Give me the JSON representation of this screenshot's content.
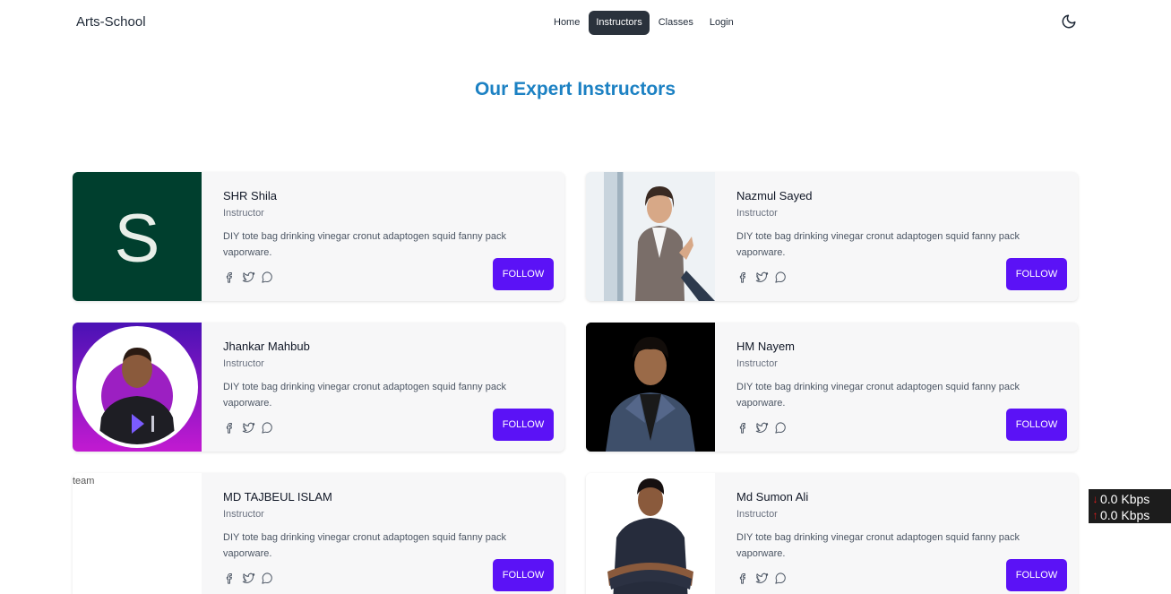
{
  "navbar": {
    "brand": "Arts-School",
    "menu": [
      {
        "label": "Home",
        "active": false
      },
      {
        "label": "Instructors",
        "active": true
      },
      {
        "label": "Classes",
        "active": false
      },
      {
        "label": "Login",
        "active": false
      }
    ],
    "theme_icon": "moon-icon"
  },
  "page": {
    "heading": "Our Expert Instructors"
  },
  "instructors": [
    {
      "name": "SHR Shila",
      "role": "Instructor",
      "description": "DIY tote bag drinking vinegar cronut adaptogen squid fanny pack vaporware.",
      "button": "FOLLOW",
      "image": "letter-s-avatar",
      "avatar_letter": "S"
    },
    {
      "name": "Nazmul Sayed",
      "role": "Instructor",
      "description": "DIY tote bag drinking vinegar cronut adaptogen squid fanny pack vaporware.",
      "button": "FOLLOW",
      "image": "woman-business-photo"
    },
    {
      "name": "Jhankar Mahbub",
      "role": "Instructor",
      "description": "DIY tote bag drinking vinegar cronut adaptogen squid fanny pack vaporware.",
      "button": "FOLLOW",
      "image": "man-purple-circle-photo"
    },
    {
      "name": "HM Nayem",
      "role": "Instructor",
      "description": "DIY tote bag drinking vinegar cronut adaptogen squid fanny pack vaporware.",
      "button": "FOLLOW",
      "image": "man-suit-black-bg-photo"
    },
    {
      "name": "MD TAJBEUL ISLAM",
      "role": "Instructor",
      "description": "DIY tote bag drinking vinegar cronut adaptogen squid fanny pack vaporware.",
      "button": "FOLLOW",
      "image": "broken-image",
      "image_alt": "team"
    },
    {
      "name": "Md Sumon Ali",
      "role": "Instructor",
      "description": "DIY tote bag drinking vinegar cronut adaptogen squid fanny pack vaporware.",
      "button": "FOLLOW",
      "image": "man-crossed-arms-photo"
    }
  ],
  "social_icons": [
    "facebook-icon",
    "twitter-icon",
    "chat-icon"
  ],
  "netmeter": {
    "download": "0.0 Kbps",
    "upload": "0.0 Kbps"
  },
  "colors": {
    "heading": "#1c81c3",
    "button": "#5b12f6",
    "active_nav": "#2a323c",
    "card_bg": "#f7f7f8"
  }
}
